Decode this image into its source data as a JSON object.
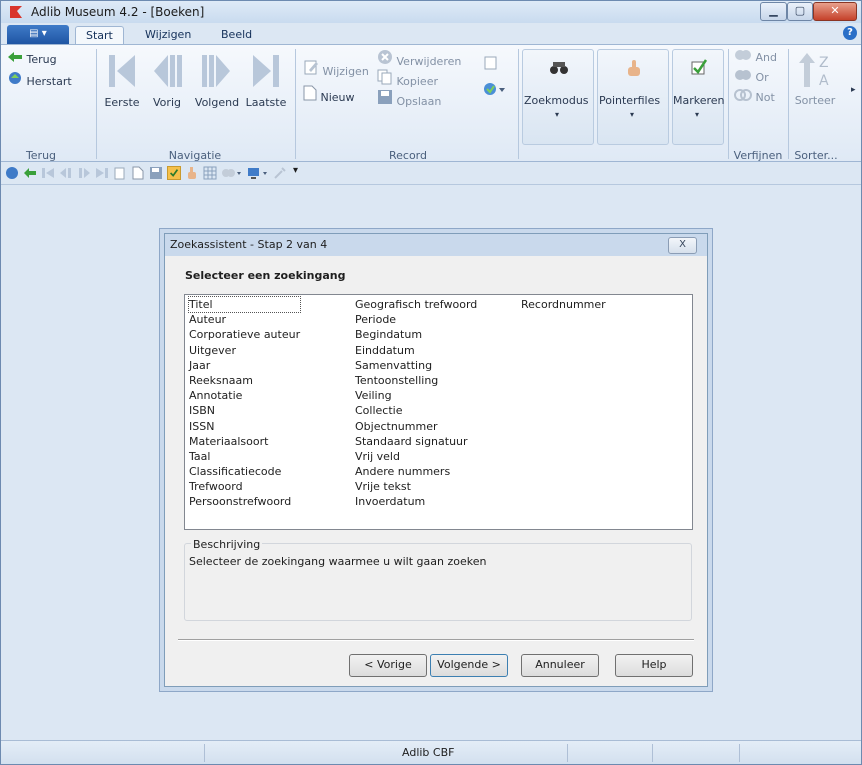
{
  "window": {
    "title": "Adlib Museum 4.2 - [Boeken]"
  },
  "ribbon_tabs": [
    "Start",
    "Wijzigen",
    "Beeld"
  ],
  "ribbon": {
    "back": "Terug",
    "restart": "Herstart",
    "first": "Eerste",
    "prev": "Vorig",
    "next": "Volgend",
    "last": "Laatste",
    "edit": "Wijzigen",
    "new": "Nieuw",
    "delete": "Verwijderen",
    "copy": "Kopieer",
    "save": "Opslaan",
    "searchmode": "Zoekmodus",
    "pointerfiles": "Pointerfiles",
    "mark": "Markeren",
    "and": "And",
    "or": "Or",
    "not": "Not",
    "sort": "Sorteer",
    "groups": {
      "terug": "Terug",
      "navigatie": "Navigatie",
      "record": "Record",
      "verfijnen": "Verfijnen",
      "sorteer": "Sorter..."
    }
  },
  "dialog": {
    "title": "Zoekassistent - Stap 2 van 4",
    "close": "X",
    "heading": "Selecteer een zoekingang",
    "columns": [
      [
        "Titel",
        "Auteur",
        "Corporatieve auteur",
        "Uitgever",
        "Jaar",
        "Reeksnaam",
        "Annotatie",
        "ISBN",
        "ISSN",
        "Materiaalsoort",
        "Taal",
        "Classificatiecode",
        "Trefwoord",
        "Persoonstrefwoord"
      ],
      [
        "Geografisch trefwoord",
        "Periode",
        "Begindatum",
        "Einddatum",
        "Samenvatting",
        "Tentoonstelling",
        "Veiling",
        "Collectie",
        "Objectnummer",
        "Standaard signatuur",
        "Vrij veld",
        "Andere nummers",
        "Vrije tekst",
        "Invoerdatum"
      ],
      [
        "Recordnummer"
      ]
    ],
    "description_label": "Beschrijving",
    "description_text": "Selecteer de zoekingang waarmee u wilt gaan zoeken",
    "buttons": {
      "prev": "< Vorige",
      "next": "Volgende >",
      "cancel": "Annuleer",
      "help": "Help"
    }
  },
  "statusbar": {
    "text": "Adlib CBF"
  },
  "colors": {
    "accent": "#2b6fc7",
    "ribbon_bg": "#dce7f3",
    "dialog_bg": "#f0f0f0"
  }
}
